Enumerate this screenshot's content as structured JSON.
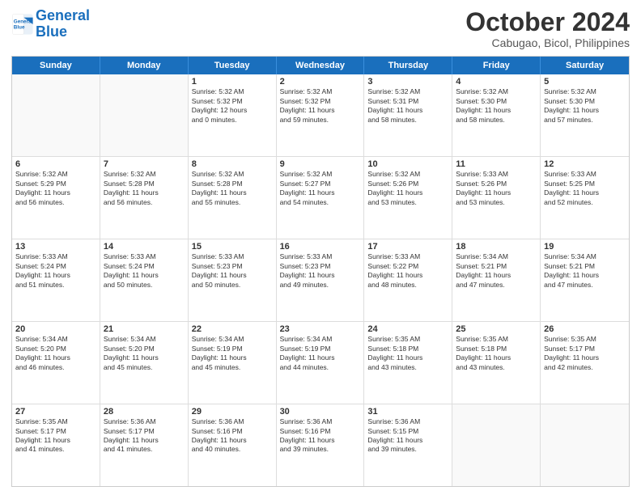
{
  "logo": {
    "line1": "General",
    "line2": "Blue"
  },
  "title": "October 2024",
  "subtitle": "Cabugao, Bicol, Philippines",
  "days_of_week": [
    "Sunday",
    "Monday",
    "Tuesday",
    "Wednesday",
    "Thursday",
    "Friday",
    "Saturday"
  ],
  "weeks": [
    [
      {
        "day": "",
        "info": "",
        "empty": true
      },
      {
        "day": "",
        "info": "",
        "empty": true
      },
      {
        "day": "1",
        "info": "Sunrise: 5:32 AM\nSunset: 5:32 PM\nDaylight: 12 hours\nand 0 minutes.",
        "empty": false
      },
      {
        "day": "2",
        "info": "Sunrise: 5:32 AM\nSunset: 5:32 PM\nDaylight: 11 hours\nand 59 minutes.",
        "empty": false
      },
      {
        "day": "3",
        "info": "Sunrise: 5:32 AM\nSunset: 5:31 PM\nDaylight: 11 hours\nand 58 minutes.",
        "empty": false
      },
      {
        "day": "4",
        "info": "Sunrise: 5:32 AM\nSunset: 5:30 PM\nDaylight: 11 hours\nand 58 minutes.",
        "empty": false
      },
      {
        "day": "5",
        "info": "Sunrise: 5:32 AM\nSunset: 5:30 PM\nDaylight: 11 hours\nand 57 minutes.",
        "empty": false
      }
    ],
    [
      {
        "day": "6",
        "info": "Sunrise: 5:32 AM\nSunset: 5:29 PM\nDaylight: 11 hours\nand 56 minutes.",
        "empty": false
      },
      {
        "day": "7",
        "info": "Sunrise: 5:32 AM\nSunset: 5:28 PM\nDaylight: 11 hours\nand 56 minutes.",
        "empty": false
      },
      {
        "day": "8",
        "info": "Sunrise: 5:32 AM\nSunset: 5:28 PM\nDaylight: 11 hours\nand 55 minutes.",
        "empty": false
      },
      {
        "day": "9",
        "info": "Sunrise: 5:32 AM\nSunset: 5:27 PM\nDaylight: 11 hours\nand 54 minutes.",
        "empty": false
      },
      {
        "day": "10",
        "info": "Sunrise: 5:32 AM\nSunset: 5:26 PM\nDaylight: 11 hours\nand 53 minutes.",
        "empty": false
      },
      {
        "day": "11",
        "info": "Sunrise: 5:33 AM\nSunset: 5:26 PM\nDaylight: 11 hours\nand 53 minutes.",
        "empty": false
      },
      {
        "day": "12",
        "info": "Sunrise: 5:33 AM\nSunset: 5:25 PM\nDaylight: 11 hours\nand 52 minutes.",
        "empty": false
      }
    ],
    [
      {
        "day": "13",
        "info": "Sunrise: 5:33 AM\nSunset: 5:24 PM\nDaylight: 11 hours\nand 51 minutes.",
        "empty": false
      },
      {
        "day": "14",
        "info": "Sunrise: 5:33 AM\nSunset: 5:24 PM\nDaylight: 11 hours\nand 50 minutes.",
        "empty": false
      },
      {
        "day": "15",
        "info": "Sunrise: 5:33 AM\nSunset: 5:23 PM\nDaylight: 11 hours\nand 50 minutes.",
        "empty": false
      },
      {
        "day": "16",
        "info": "Sunrise: 5:33 AM\nSunset: 5:23 PM\nDaylight: 11 hours\nand 49 minutes.",
        "empty": false
      },
      {
        "day": "17",
        "info": "Sunrise: 5:33 AM\nSunset: 5:22 PM\nDaylight: 11 hours\nand 48 minutes.",
        "empty": false
      },
      {
        "day": "18",
        "info": "Sunrise: 5:34 AM\nSunset: 5:21 PM\nDaylight: 11 hours\nand 47 minutes.",
        "empty": false
      },
      {
        "day": "19",
        "info": "Sunrise: 5:34 AM\nSunset: 5:21 PM\nDaylight: 11 hours\nand 47 minutes.",
        "empty": false
      }
    ],
    [
      {
        "day": "20",
        "info": "Sunrise: 5:34 AM\nSunset: 5:20 PM\nDaylight: 11 hours\nand 46 minutes.",
        "empty": false
      },
      {
        "day": "21",
        "info": "Sunrise: 5:34 AM\nSunset: 5:20 PM\nDaylight: 11 hours\nand 45 minutes.",
        "empty": false
      },
      {
        "day": "22",
        "info": "Sunrise: 5:34 AM\nSunset: 5:19 PM\nDaylight: 11 hours\nand 45 minutes.",
        "empty": false
      },
      {
        "day": "23",
        "info": "Sunrise: 5:34 AM\nSunset: 5:19 PM\nDaylight: 11 hours\nand 44 minutes.",
        "empty": false
      },
      {
        "day": "24",
        "info": "Sunrise: 5:35 AM\nSunset: 5:18 PM\nDaylight: 11 hours\nand 43 minutes.",
        "empty": false
      },
      {
        "day": "25",
        "info": "Sunrise: 5:35 AM\nSunset: 5:18 PM\nDaylight: 11 hours\nand 43 minutes.",
        "empty": false
      },
      {
        "day": "26",
        "info": "Sunrise: 5:35 AM\nSunset: 5:17 PM\nDaylight: 11 hours\nand 42 minutes.",
        "empty": false
      }
    ],
    [
      {
        "day": "27",
        "info": "Sunrise: 5:35 AM\nSunset: 5:17 PM\nDaylight: 11 hours\nand 41 minutes.",
        "empty": false
      },
      {
        "day": "28",
        "info": "Sunrise: 5:36 AM\nSunset: 5:17 PM\nDaylight: 11 hours\nand 41 minutes.",
        "empty": false
      },
      {
        "day": "29",
        "info": "Sunrise: 5:36 AM\nSunset: 5:16 PM\nDaylight: 11 hours\nand 40 minutes.",
        "empty": false
      },
      {
        "day": "30",
        "info": "Sunrise: 5:36 AM\nSunset: 5:16 PM\nDaylight: 11 hours\nand 39 minutes.",
        "empty": false
      },
      {
        "day": "31",
        "info": "Sunrise: 5:36 AM\nSunset: 5:15 PM\nDaylight: 11 hours\nand 39 minutes.",
        "empty": false
      },
      {
        "day": "",
        "info": "",
        "empty": true
      },
      {
        "day": "",
        "info": "",
        "empty": true
      }
    ]
  ]
}
